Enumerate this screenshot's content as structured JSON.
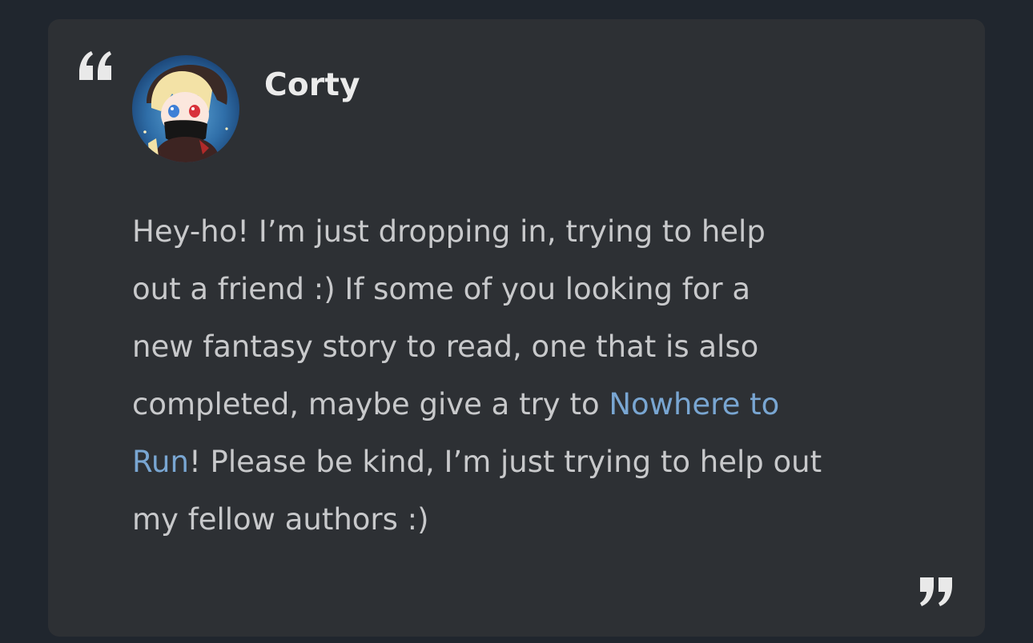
{
  "comment": {
    "author": "Corty",
    "avatar_icon": "anime-avatar-icon",
    "lines": [
      {
        "before": "Hey-ho! I’m just dropping in, trying to help"
      },
      {
        "before": "out a friend :) If some of you looking for a"
      },
      {
        "before": "new fantasy story to read, one that is also"
      },
      {
        "before": "completed, maybe give a try to ",
        "link": "Nowhere to"
      },
      {
        "link": "Run",
        "after": "! Please be kind, I’m just trying to help out"
      },
      {
        "before": "my fellow authors :)"
      }
    ]
  },
  "icons": {
    "open_quote": "open-quote-icon",
    "close_quote": "close-quote-icon"
  },
  "colors": {
    "page_background": "#20262e",
    "card_background": "#2d3034",
    "text": "#c8c9cb",
    "author": "#ebebeb",
    "link": "#79a6d2",
    "quote_marks": "#e9e9e9"
  }
}
